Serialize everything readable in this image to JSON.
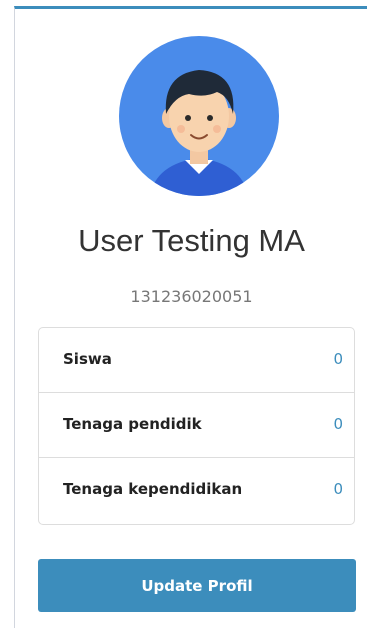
{
  "profile": {
    "name": "User Testing MA",
    "id_number": "131236020051",
    "avatar_icon": "user-avatar-icon"
  },
  "stats": [
    {
      "label": "Siswa",
      "value": "0"
    },
    {
      "label": "Tenaga pendidik",
      "value": "0"
    },
    {
      "label": "Tenaga kependidikan",
      "value": "0"
    }
  ],
  "actions": {
    "update_label": "Update Profil"
  },
  "colors": {
    "accent": "#3c8dbc",
    "avatar_bg": "#4a8bea"
  }
}
